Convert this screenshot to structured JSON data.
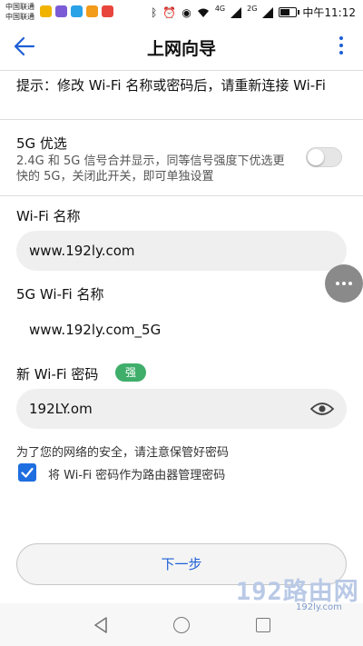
{
  "status_bar": {
    "carrier_1": "中国联通",
    "carrier_2": "中国联通",
    "network_1": "4G",
    "network_2": "2G",
    "time": "中午11:12",
    "battery_level": 0.55
  },
  "header": {
    "title": "上网向导",
    "back_icon": "arrow-left-icon",
    "more_icon": "more-vertical-icon",
    "accent_color": "#1e5fd6"
  },
  "tip": "提示：修改 Wi-Fi 名称或密码后，请重新连接 Wi-Fi",
  "five_g_preference": {
    "title": "5G 优选",
    "description": "2.4G 和 5G 信号合并显示，同等信号强度下优选更快的 5G，关闭此开关，即可单独设置",
    "enabled": false
  },
  "wifi_name": {
    "label": "Wi-Fi 名称",
    "value": "www.192ly.com"
  },
  "wifi_5g_name": {
    "label": "5G Wi-Fi 名称",
    "value": "www.192ly.com_5G"
  },
  "new_password": {
    "label": "新 Wi-Fi 密码",
    "strength": "强",
    "strength_color": "#3fae6b",
    "value": "192LY.om",
    "visibility_icon": "eye-icon"
  },
  "security_hint": "为了您的网络的安全，请注意保管好密码",
  "use_as_admin": {
    "checked": true,
    "label": "将 Wi-Fi 密码作为路由器管理密码"
  },
  "next_button": "下一步",
  "watermark": {
    "main": "192路由网",
    "sub": "192ly.com"
  }
}
